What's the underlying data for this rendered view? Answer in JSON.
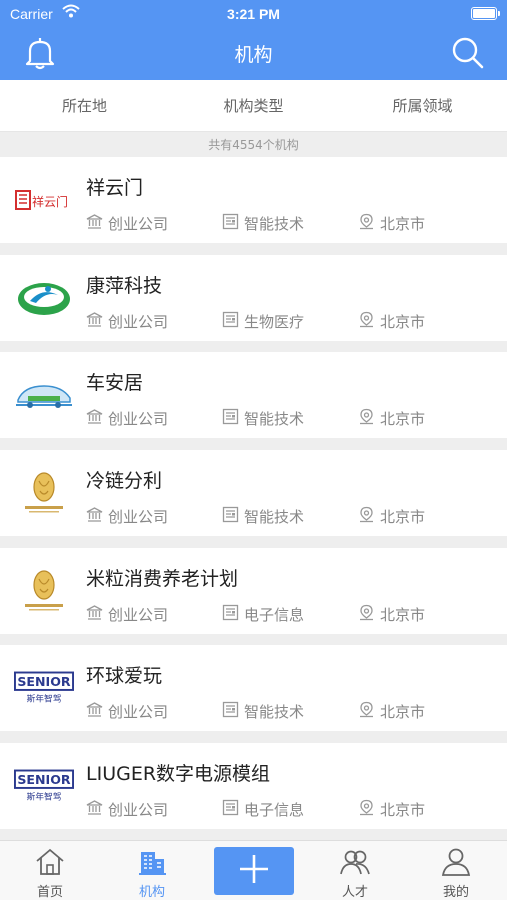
{
  "status": {
    "carrier": "Carrier",
    "time": "3:21 PM"
  },
  "navbar": {
    "title": "机构",
    "left_icon": "bell-icon",
    "right_icon": "search-icon"
  },
  "filters": [
    "所在地",
    "机构类型",
    "所属领域"
  ],
  "count_text": "共有4554个机构",
  "colors": {
    "primary": "#5595f3",
    "text": "#222222",
    "muted": "#888888",
    "background": "#eeeeee"
  },
  "items": [
    {
      "name": "祥云门",
      "type": "创业公司",
      "field": "智能技术",
      "city": "北京市",
      "logo_text": "祥云门"
    },
    {
      "name": "康萍科技",
      "type": "创业公司",
      "field": "生物医疗",
      "city": "北京市"
    },
    {
      "name": "车安居",
      "type": "创业公司",
      "field": "智能技术",
      "city": "北京市"
    },
    {
      "name": "冷链分利",
      "type": "创业公司",
      "field": "智能技术",
      "city": "北京市"
    },
    {
      "name": "米粒消费养老计划",
      "type": "创业公司",
      "field": "电子信息",
      "city": "北京市"
    },
    {
      "name": "环球爱玩",
      "type": "创业公司",
      "field": "智能技术",
      "city": "北京市",
      "logo_text": "SENIOR",
      "logo_sub": "斯年智驾"
    },
    {
      "name": "LIUGER数字电源模组",
      "type": "创业公司",
      "field": "电子信息",
      "city": "北京市",
      "logo_text": "SENIOR",
      "logo_sub": "斯年智驾"
    }
  ],
  "tabs": [
    {
      "label": "首页",
      "icon": "home-icon"
    },
    {
      "label": "机构",
      "icon": "building-icon",
      "active": true
    },
    {
      "label": "",
      "icon": "plus-icon"
    },
    {
      "label": "人才",
      "icon": "people-icon"
    },
    {
      "label": "我的",
      "icon": "person-icon"
    }
  ]
}
